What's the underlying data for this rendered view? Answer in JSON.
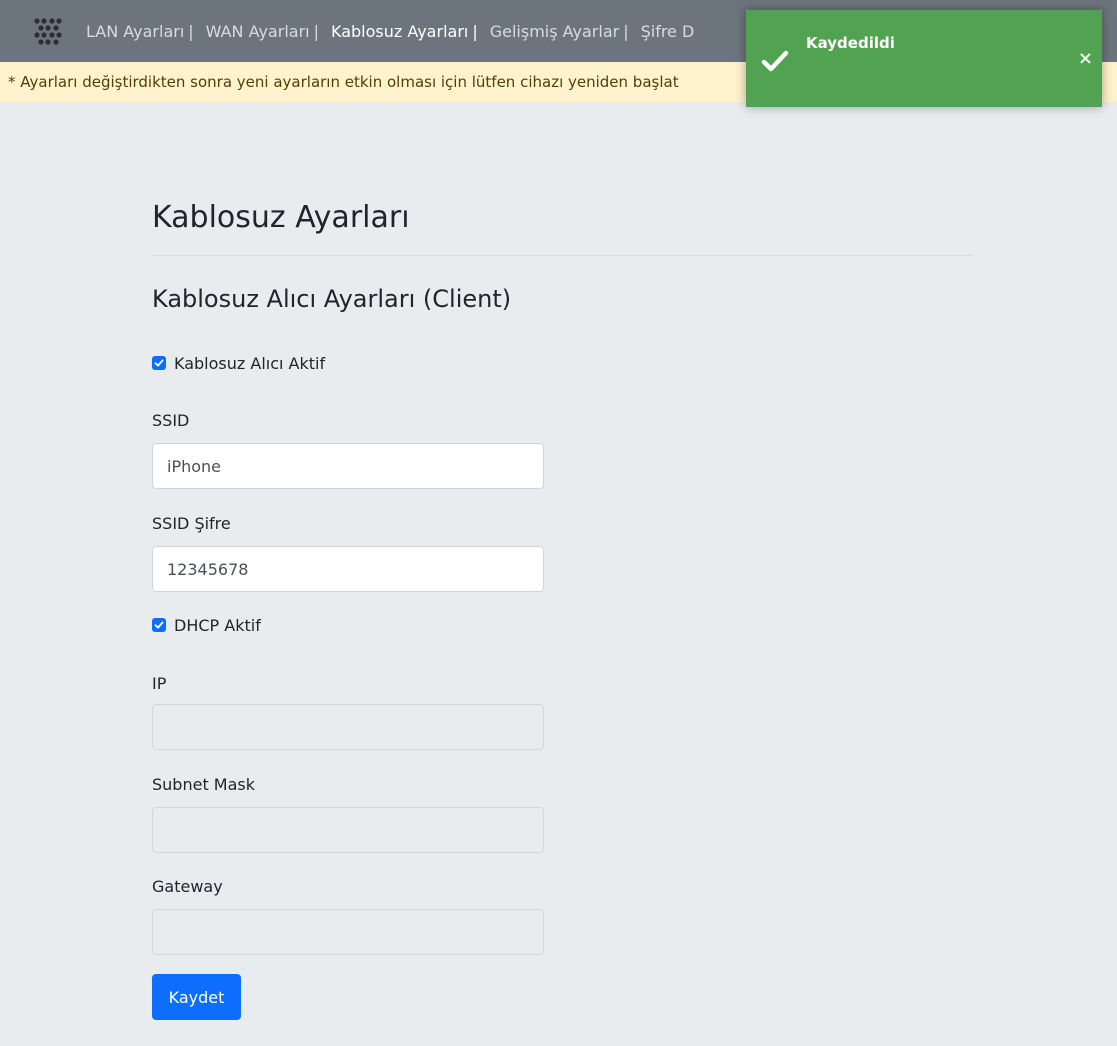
{
  "navbar": {
    "logo_icon": "brand-dots-logo",
    "items": [
      {
        "label": "LAN Ayarları",
        "sep": "|",
        "active": false
      },
      {
        "label": "WAN Ayarları",
        "sep": "|",
        "active": false
      },
      {
        "label": "Kablosuz Ayarları",
        "sep": "|",
        "active": true
      },
      {
        "label": "Gelişmiş Ayarlar",
        "sep": "|",
        "active": false
      },
      {
        "label": "Şifre D",
        "sep": "",
        "active": false
      }
    ],
    "background": "#6c757d"
  },
  "warning": {
    "text": "* Ayarları değiştirdikten sonra yeni ayarların etkin olması için lütfen cihazı yeniden başlat"
  },
  "toast": {
    "title": "Kaydedildi",
    "icon": "check-icon",
    "close_label": "×",
    "color": "#51a351"
  },
  "page": {
    "title": "Kablosuz Ayarları",
    "section_title": "Kablosuz Alıcı Ayarları (Client)"
  },
  "form": {
    "wireless_client_enabled": {
      "label": "Kablosuz Alıcı Aktif",
      "checked": true
    },
    "ssid": {
      "label": "SSID",
      "value": "iPhone"
    },
    "ssid_password": {
      "label": "SSID Şifre",
      "value": "12345678"
    },
    "dhcp_enabled": {
      "label": "DHCP Aktif",
      "checked": true
    },
    "ip": {
      "label": "IP",
      "value": ""
    },
    "subnet_mask": {
      "label": "Subnet Mask",
      "value": ""
    },
    "gateway": {
      "label": "Gateway",
      "value": ""
    },
    "save_label": "Kaydet"
  },
  "colors": {
    "accent": "#0d6efd",
    "page_background": "#e9ecef",
    "warning_background": "#fff3cd"
  }
}
